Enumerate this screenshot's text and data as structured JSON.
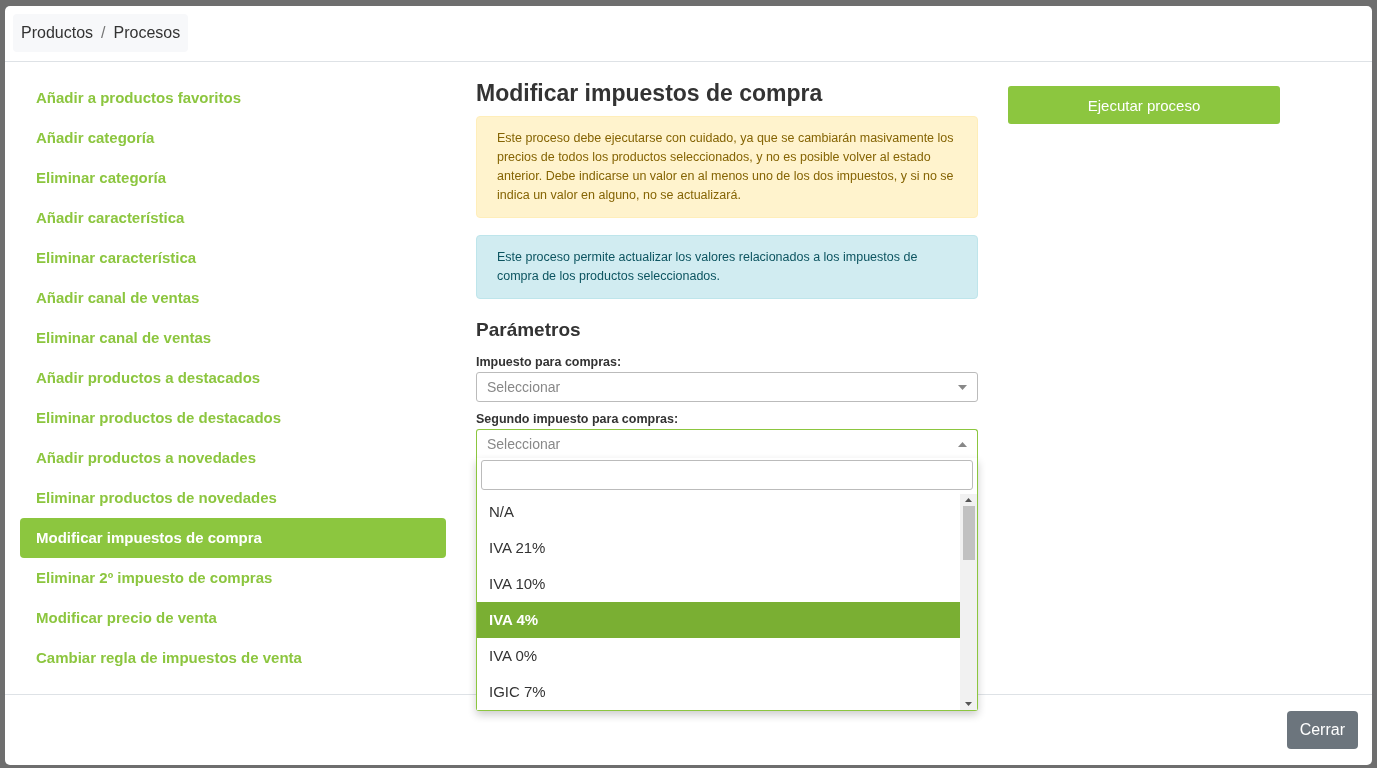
{
  "breadcrumb": {
    "items": [
      "Productos",
      "Procesos"
    ],
    "separator": "/"
  },
  "processes": [
    {
      "label": "Añadir a productos favoritos",
      "selected": false
    },
    {
      "label": "Añadir categoría",
      "selected": false
    },
    {
      "label": "Eliminar categoría",
      "selected": false
    },
    {
      "label": "Añadir característica",
      "selected": false
    },
    {
      "label": "Eliminar característica",
      "selected": false
    },
    {
      "label": "Añadir canal de ventas",
      "selected": false
    },
    {
      "label": "Eliminar canal de ventas",
      "selected": false
    },
    {
      "label": "Añadir productos a destacados",
      "selected": false
    },
    {
      "label": "Eliminar productos de destacados",
      "selected": false
    },
    {
      "label": "Añadir productos a novedades",
      "selected": false
    },
    {
      "label": "Eliminar productos de novedades",
      "selected": false
    },
    {
      "label": "Modificar impuestos de compra",
      "selected": true
    },
    {
      "label": "Eliminar 2º impuesto de compras",
      "selected": false
    },
    {
      "label": "Modificar precio de venta",
      "selected": false
    },
    {
      "label": "Cambiar regla de impuestos de venta",
      "selected": false
    }
  ],
  "title": "Modificar impuestos de compra",
  "alerts": [
    {
      "kind": "warning",
      "text": "Este proceso debe ejecutarse con cuidado, ya que se cambiarán masivamente los precios de todos los productos seleccionados, y no es posible volver al estado anterior. Debe indicarse un valor en al menos uno de los dos impuestos, y si no se indica un valor en alguno, no se actualizará."
    },
    {
      "kind": "info",
      "text": "Este proceso permite actualizar los valores relacionados a los impuestos de compra de los productos seleccionados."
    }
  ],
  "parameters_title": "Parámetros",
  "fields": [
    {
      "label": "Impuesto para compras:",
      "placeholder": "Seleccionar",
      "expanded": false
    },
    {
      "label": "Segundo impuesto para compras:",
      "placeholder": "Seleccionar",
      "expanded": true,
      "options": [
        {
          "label": "N/A",
          "selected": false
        },
        {
          "label": "IVA 21%",
          "selected": false
        },
        {
          "label": "IVA 10%",
          "selected": false
        },
        {
          "label": "IVA 4%",
          "selected": true
        },
        {
          "label": "IVA 0%",
          "selected": false
        },
        {
          "label": "IGIC 7%",
          "selected": false
        }
      ]
    }
  ],
  "run_button": "Ejecutar proceso",
  "close_button": "Cerrar"
}
